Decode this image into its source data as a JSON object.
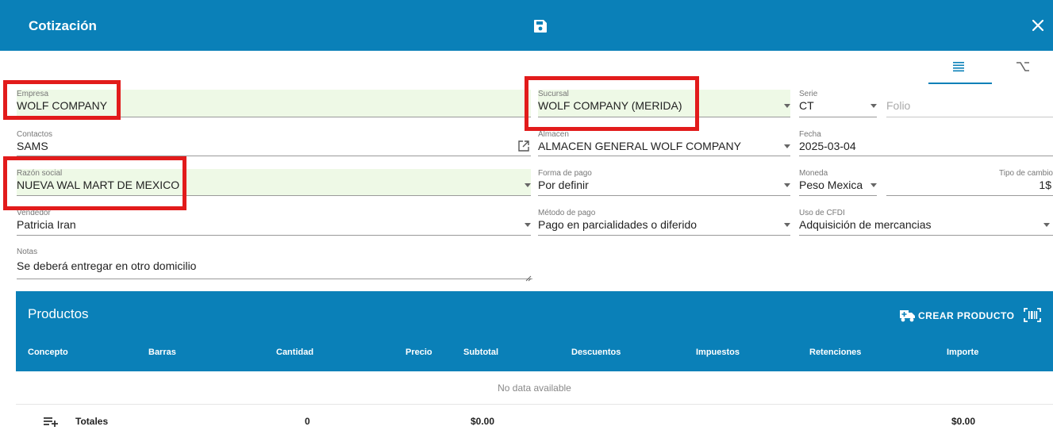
{
  "header": {
    "title": "Cotización",
    "save_icon": "save-icon",
    "close_icon": "close-icon",
    "bg_color": "#0a80b8"
  },
  "view_tabs": [
    {
      "icon": "list-view-icon",
      "active": true
    },
    {
      "icon": "option-icon",
      "active": false
    }
  ],
  "form": {
    "empresa": {
      "label": "Empresa",
      "value": "WOLF COMPANY"
    },
    "sucursal": {
      "label": "Sucursal",
      "value": "WOLF COMPANY (MERIDA)"
    },
    "serie": {
      "label": "Serie",
      "value": "CT"
    },
    "folio": {
      "placeholder": "Folio"
    },
    "contactos": {
      "label": "Contactos",
      "value": "SAMS"
    },
    "almacen": {
      "label": "Almacen",
      "value": "ALMACEN GENERAL WOLF COMPANY"
    },
    "fecha": {
      "label": "Fecha",
      "value": "2025-03-04"
    },
    "razon_social": {
      "label": "Razón social",
      "value": "NUEVA WAL MART DE MEXICO"
    },
    "forma_pago": {
      "label": "Forma de pago",
      "value": "Por definir"
    },
    "moneda": {
      "label": "Moneda",
      "value": "Peso Mexica"
    },
    "tipo_cambio": {
      "label": "Tipo de cambio",
      "value": "1$"
    },
    "vendedor": {
      "label": "Vendedor",
      "value": "Patricia Iran"
    },
    "metodo_pago": {
      "label": "Método de pago",
      "value": "Pago en parcialidades o diferido"
    },
    "uso_cfdi": {
      "label": "Uso de CFDI",
      "value": "Adquisición de mercancias"
    },
    "notas": {
      "label": "Notas",
      "value": "Se deberá entregar en otro domicilio"
    }
  },
  "products": {
    "title": "Productos",
    "create_label": "CREAR PRODUCTO",
    "columns": [
      "Concepto",
      "Barras",
      "Cantidad",
      "Precio",
      "Subtotal",
      "Descuentos",
      "Impuestos",
      "Retenciones",
      "Importe"
    ],
    "empty_text": "No data available",
    "totals": {
      "label": "Totales",
      "cantidad": "0",
      "subtotal": "$0.00",
      "importe": "$0.00"
    }
  },
  "highlight_color": "#e21b1b"
}
